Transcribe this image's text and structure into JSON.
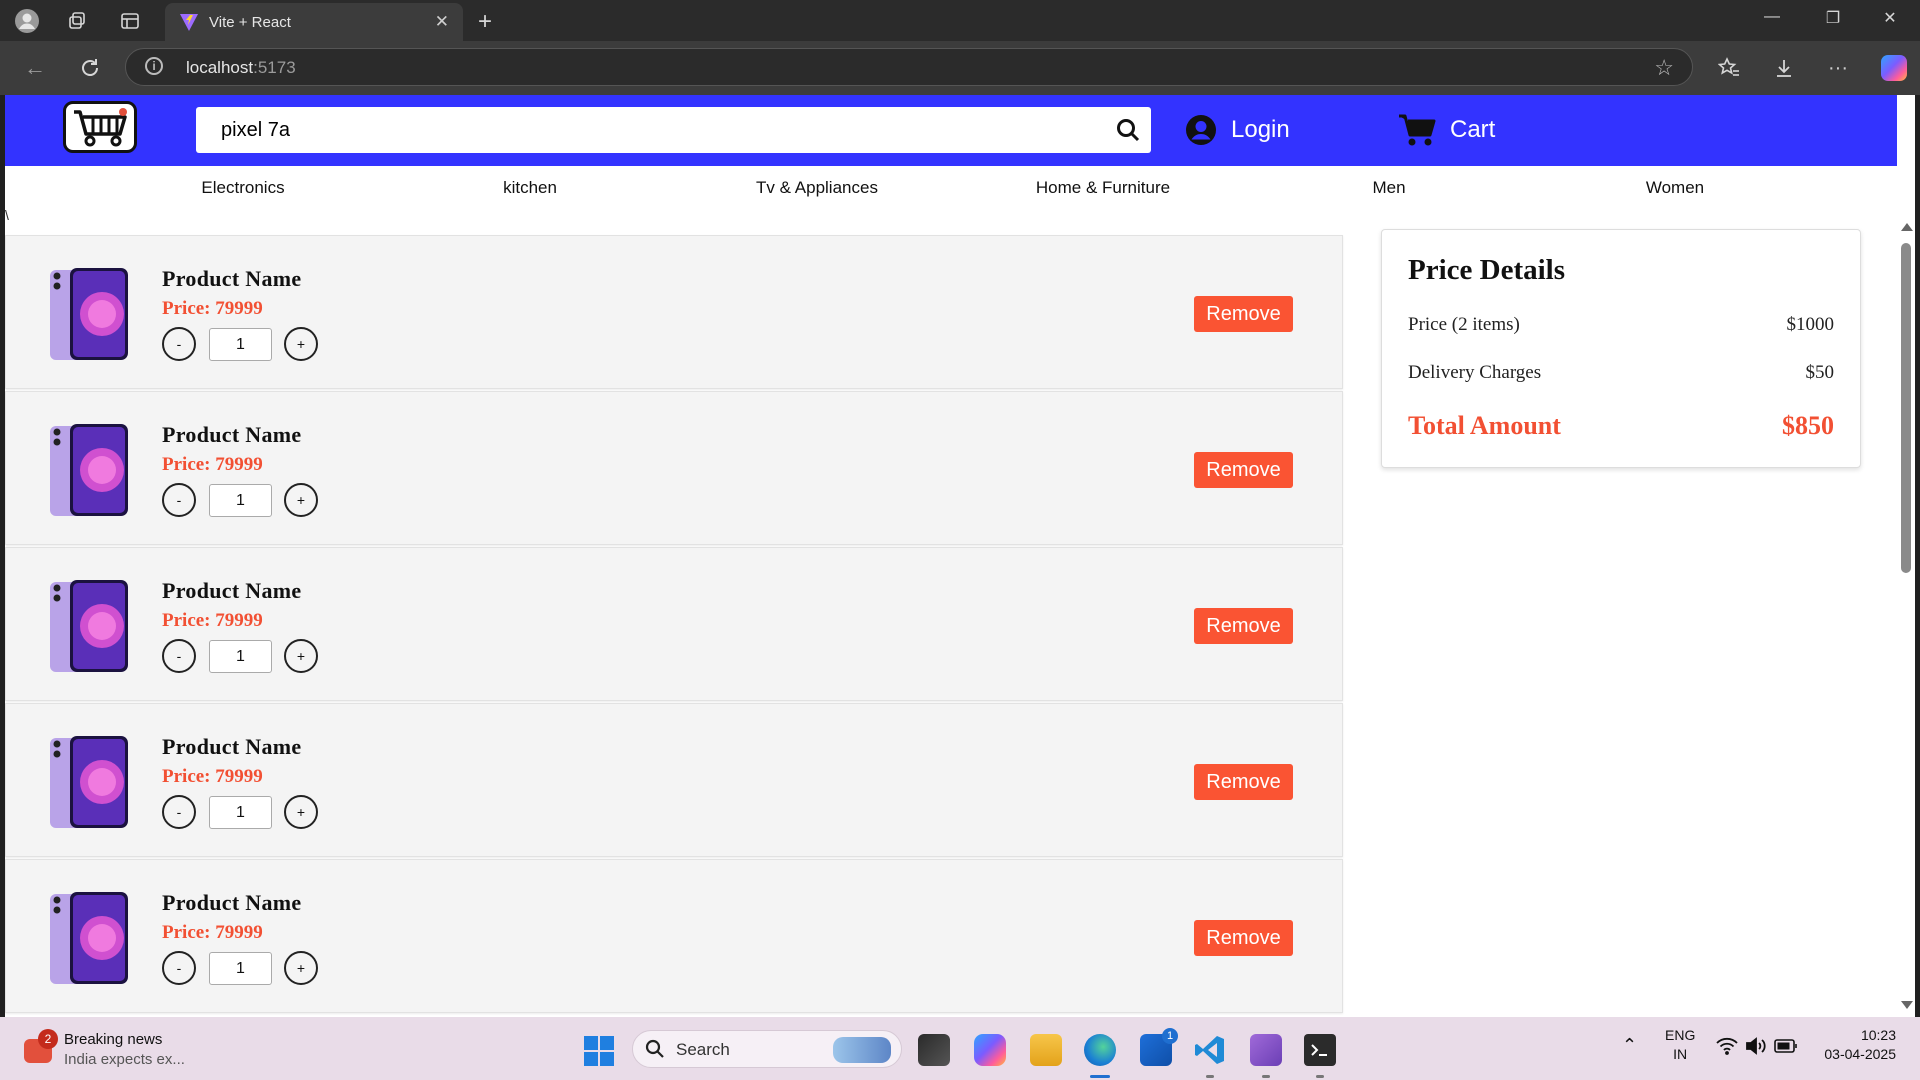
{
  "browser": {
    "tab_title": "Vite + React",
    "url_host": "localhost",
    "url_port": ":5173"
  },
  "header": {
    "search_value": "pixel 7a",
    "login_label": "Login",
    "cart_label": "Cart",
    "accent_color": "#3333ff"
  },
  "categories": [
    "Electronics",
    "kitchen",
    "Tv & Appliances",
    "Home & Furniture",
    "Men",
    "Women"
  ],
  "stray_text": "\\",
  "cart_items": [
    {
      "name": "Product Name",
      "price": "Price: 79999",
      "quantity": "1",
      "minus": "-",
      "plus": "+",
      "remove": "Remove"
    },
    {
      "name": "Product Name",
      "price": "Price: 79999",
      "quantity": "1",
      "minus": "-",
      "plus": "+",
      "remove": "Remove"
    },
    {
      "name": "Product Name",
      "price": "Price: 79999",
      "quantity": "1",
      "minus": "-",
      "plus": "+",
      "remove": "Remove"
    },
    {
      "name": "Product Name",
      "price": "Price: 79999",
      "quantity": "1",
      "minus": "-",
      "plus": "+",
      "remove": "Remove"
    },
    {
      "name": "Product Name",
      "price": "Price: 79999",
      "quantity": "1",
      "minus": "-",
      "plus": "+",
      "remove": "Remove"
    }
  ],
  "price_details": {
    "title": "Price Details",
    "price_label": "Price (2 items)",
    "price_value": "$1000",
    "delivery_label": "Delivery Charges",
    "delivery_value": "$50",
    "total_label": "Total Amount",
    "total_value": "$850",
    "highlight_color": "#f25033"
  },
  "taskbar": {
    "news_badge": "2",
    "news_title": "Breaking news",
    "news_subtitle": "India expects ex...",
    "search_label": "Search",
    "store_badge": "1",
    "lang_line1": "ENG",
    "lang_line2": "IN",
    "time": "10:23",
    "date": "03-04-2025"
  }
}
